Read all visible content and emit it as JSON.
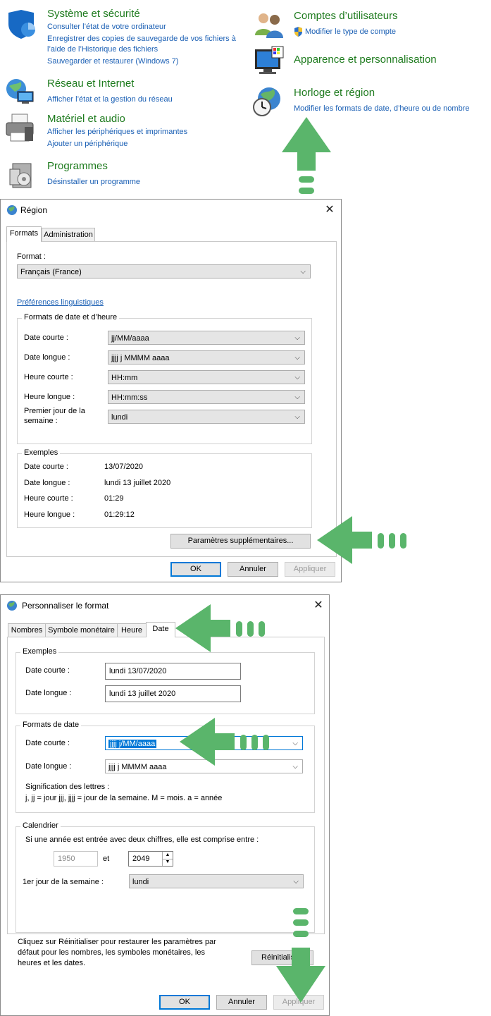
{
  "control_panel": {
    "system": {
      "title": "Système et sécurité",
      "links": [
        "Consulter l’état de votre ordinateur",
        "Enregistrer des copies de sauvegarde de vos fichiers à",
        "l’aide de l’Historique des fichiers",
        "Sauvegarder et restaurer (Windows 7)"
      ]
    },
    "network": {
      "title": "Réseau et Internet",
      "links": [
        "Afficher l’état et la gestion du réseau"
      ]
    },
    "hardware": {
      "title": "Matériel et audio",
      "links": [
        "Afficher les périphériques et imprimantes",
        "Ajouter un périphérique"
      ]
    },
    "programs": {
      "title": "Programmes",
      "links": [
        "Désinstaller un programme"
      ]
    },
    "accounts": {
      "title": "Comptes d’utilisateurs",
      "links": [
        "Modifier le type de compte"
      ]
    },
    "appearance": {
      "title": "Apparence et personnalisation"
    },
    "clock": {
      "title": "Horloge et région",
      "links": [
        "Modifier les formats de date, d’heure ou de nombre"
      ]
    }
  },
  "region_dialog": {
    "title": "Région",
    "tabs": [
      "Formats",
      "Administration"
    ],
    "format_label": "Format :",
    "format_value": "Français (France)",
    "lang_prefs_link": "Préférences linguistiques",
    "group_datetime": "Formats de date et d’heure",
    "rows": [
      {
        "label": "Date courte :",
        "value": "jj/MM/aaaa"
      },
      {
        "label": "Date longue :",
        "value": "jjjj j MMMM aaaa"
      },
      {
        "label": "Heure courte :",
        "value": "HH:mm"
      },
      {
        "label": "Heure longue :",
        "value": "HH:mm:ss"
      },
      {
        "label": "Premier jour de la semaine :",
        "value": "lundi"
      }
    ],
    "first_day_line1": "Premier jour de la",
    "first_day_line2": "semaine :",
    "group_examples": "Exemples",
    "examples": [
      {
        "label": "Date courte :",
        "value": "13/07/2020"
      },
      {
        "label": "Date longue :",
        "value": "lundi 13 juillet 2020"
      },
      {
        "label": "Heure courte :",
        "value": "01:29"
      },
      {
        "label": "Heure longue :",
        "value": "01:29:12"
      }
    ],
    "additional_button": "Paramètres supplémentaires...",
    "ok": "OK",
    "cancel": "Annuler",
    "apply": "Appliquer"
  },
  "customize_dialog": {
    "title": "Personnaliser le format",
    "tabs": [
      "Nombres",
      "Symbole monétaire",
      "Heure",
      "Date"
    ],
    "group_examples": "Exemples",
    "example_short_label": "Date courte :",
    "example_short_value": "lundi 13/07/2020",
    "example_long_label": "Date longue :",
    "example_long_value": "lundi 13 juillet 2020",
    "group_formats": "Formats de date",
    "short_label": "Date courte :",
    "short_value": "jjjj j/MM/aaaa",
    "long_label": "Date longue :",
    "long_value": "jjjj j MMMM aaaa",
    "letters_title": "Signification des lettres :",
    "letters_text": "j, jj = jour  jjj, jjjj = jour de la semaine. M = mois. a = année",
    "group_calendar": "Calendrier",
    "calendar_text": "Si une année est entrée avec deux chiffres, elle est comprise entre :",
    "year_from": "1950",
    "year_and": "et",
    "year_to": "2049",
    "first_day_label": "1er jour de la semaine :",
    "first_day_value": "lundi",
    "reset_text_1": "Cliquez sur Réinitialiser pour restaurer les paramètres par",
    "reset_text_2": "défaut pour les nombres, les symboles monétaires, les",
    "reset_text_3": "heures et les dates.",
    "reset_button": "Réinitialiser",
    "ok": "OK",
    "cancel": "Annuler",
    "apply": "Appliquer"
  },
  "colors": {
    "arrow": "#5ab56b",
    "link": "#1a5fb4",
    "title_green": "#1e7b1e",
    "accent": "#0078d7"
  }
}
